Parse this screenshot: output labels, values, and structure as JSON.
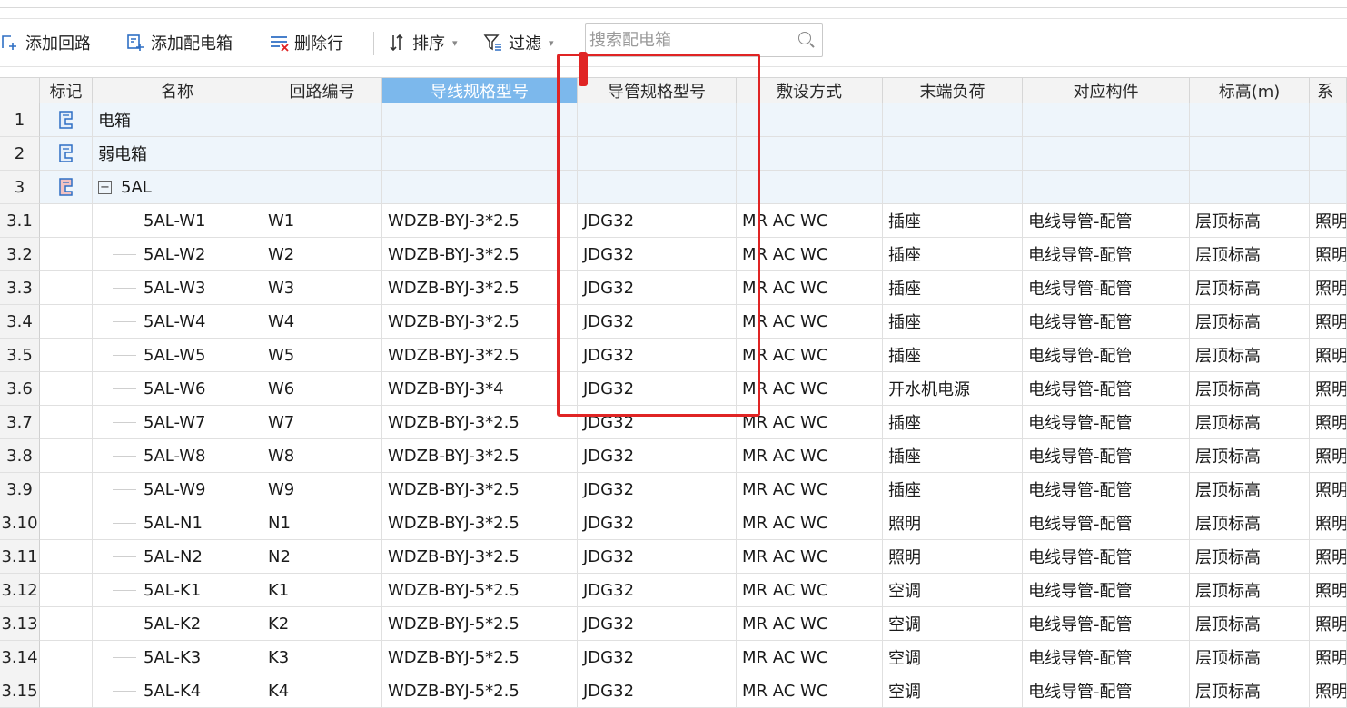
{
  "toolbar": {
    "add_circuit": "添加回路",
    "add_box": "添加配电箱",
    "delete_row": "删除行",
    "sort": "排序",
    "filter": "过滤",
    "search_placeholder": "搜索配电箱"
  },
  "columns": [
    "标记",
    "名称",
    "回路编号",
    "导线规格型号",
    "导管规格型号",
    "敷设方式",
    "末端负荷",
    "对应构件",
    "标高(m)",
    "系"
  ],
  "selected_column": "导线规格型号",
  "group_rows": [
    {
      "num": "1",
      "name": "电箱",
      "icon": "distribution-box-icon"
    },
    {
      "num": "2",
      "name": "弱电箱",
      "icon": "distribution-box-icon"
    },
    {
      "num": "3",
      "name": "5AL",
      "icon": "distribution-box-red-icon",
      "expander": "−"
    }
  ],
  "rows": [
    {
      "num": "3.1",
      "name": "5AL-W1",
      "code": "W1",
      "wire": "WDZB-BYJ-3*2.5",
      "conduit": "JDG32",
      "laying": "MR AC WC",
      "load": "插座",
      "component": "电线导管-配管",
      "elevation": "层顶标高",
      "sys": "照明"
    },
    {
      "num": "3.2",
      "name": "5AL-W2",
      "code": "W2",
      "wire": "WDZB-BYJ-3*2.5",
      "conduit": "JDG32",
      "laying": "MR AC WC",
      "load": "插座",
      "component": "电线导管-配管",
      "elevation": "层顶标高",
      "sys": "照明"
    },
    {
      "num": "3.3",
      "name": "5AL-W3",
      "code": "W3",
      "wire": "WDZB-BYJ-3*2.5",
      "conduit": "JDG32",
      "laying": "MR AC WC",
      "load": "插座",
      "component": "电线导管-配管",
      "elevation": "层顶标高",
      "sys": "照明"
    },
    {
      "num": "3.4",
      "name": "5AL-W4",
      "code": "W4",
      "wire": "WDZB-BYJ-3*2.5",
      "conduit": "JDG32",
      "laying": "MR AC WC",
      "load": "插座",
      "component": "电线导管-配管",
      "elevation": "层顶标高",
      "sys": "照明"
    },
    {
      "num": "3.5",
      "name": "5AL-W5",
      "code": "W5",
      "wire": "WDZB-BYJ-3*2.5",
      "conduit": "JDG32",
      "laying": "MR AC WC",
      "load": "插座",
      "component": "电线导管-配管",
      "elevation": "层顶标高",
      "sys": "照明"
    },
    {
      "num": "3.6",
      "name": "5AL-W6",
      "code": "W6",
      "wire": "WDZB-BYJ-3*4",
      "conduit": "JDG32",
      "laying": "MR AC WC",
      "load": "开水机电源",
      "component": "电线导管-配管",
      "elevation": "层顶标高",
      "sys": "照明"
    },
    {
      "num": "3.7",
      "name": "5AL-W7",
      "code": "W7",
      "wire": "WDZB-BYJ-3*2.5",
      "conduit": "JDG32",
      "laying": "MR AC WC",
      "load": "插座",
      "component": "电线导管-配管",
      "elevation": "层顶标高",
      "sys": "照明"
    },
    {
      "num": "3.8",
      "name": "5AL-W8",
      "code": "W8",
      "wire": "WDZB-BYJ-3*2.5",
      "conduit": "JDG32",
      "laying": "MR AC WC",
      "load": "插座",
      "component": "电线导管-配管",
      "elevation": "层顶标高",
      "sys": "照明"
    },
    {
      "num": "3.9",
      "name": "5AL-W9",
      "code": "W9",
      "wire": "WDZB-BYJ-3*2.5",
      "conduit": "JDG32",
      "laying": "MR AC WC",
      "load": "插座",
      "component": "电线导管-配管",
      "elevation": "层顶标高",
      "sys": "照明"
    },
    {
      "num": "3.10",
      "name": "5AL-N1",
      "code": "N1",
      "wire": "WDZB-BYJ-3*2.5",
      "conduit": "JDG32",
      "laying": "MR AC WC",
      "load": "照明",
      "component": "电线导管-配管",
      "elevation": "层顶标高",
      "sys": "照明"
    },
    {
      "num": "3.11",
      "name": "5AL-N2",
      "code": "N2",
      "wire": "WDZB-BYJ-3*2.5",
      "conduit": "JDG32",
      "laying": "MR AC WC",
      "load": "照明",
      "component": "电线导管-配管",
      "elevation": "层顶标高",
      "sys": "照明"
    },
    {
      "num": "3.12",
      "name": "5AL-K1",
      "code": "K1",
      "wire": "WDZB-BYJ-5*2.5",
      "conduit": "JDG32",
      "laying": "MR AC WC",
      "load": "空调",
      "component": "电线导管-配管",
      "elevation": "层顶标高",
      "sys": "照明"
    },
    {
      "num": "3.13",
      "name": "5AL-K2",
      "code": "K2",
      "wire": "WDZB-BYJ-5*2.5",
      "conduit": "JDG32",
      "laying": "MR AC WC",
      "load": "空调",
      "component": "电线导管-配管",
      "elevation": "层顶标高",
      "sys": "照明"
    },
    {
      "num": "3.14",
      "name": "5AL-K3",
      "code": "K3",
      "wire": "WDZB-BYJ-5*2.5",
      "conduit": "JDG32",
      "laying": "MR AC WC",
      "load": "空调",
      "component": "电线导管-配管",
      "elevation": "层顶标高",
      "sys": "照明"
    },
    {
      "num": "3.15",
      "name": "5AL-K4",
      "code": "K4",
      "wire": "WDZB-BYJ-5*2.5",
      "conduit": "JDG32",
      "laying": "MR AC WC",
      "load": "空调",
      "component": "电线导管-配管",
      "elevation": "层顶标高",
      "sys": "照明"
    }
  ],
  "colors": {
    "accent": "#7cb8ec",
    "highlight": "#e02424",
    "icon_blue": "#2f6fc4"
  }
}
